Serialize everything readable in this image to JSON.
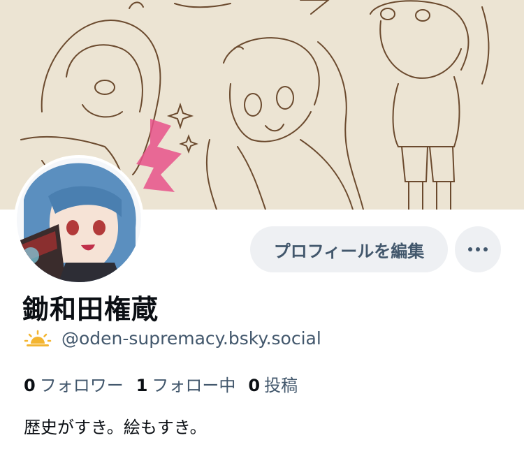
{
  "profile": {
    "display_name": "鋤和田権蔵",
    "handle": "@oden-supremacy.bsky.social",
    "handle_icon": "sunrise-icon",
    "bio": "歴史がすき。絵もすき。"
  },
  "actions": {
    "edit_label": "プロフィールを編集",
    "more_icon": "ellipsis-icon"
  },
  "stats": {
    "followers_count": "0",
    "followers_label": "フォロワー",
    "following_count": "1",
    "following_label": "フォロー中",
    "posts_count": "0",
    "posts_label": "投稿"
  },
  "colors": {
    "accent_text": "#42576c",
    "button_bg": "#eef0f3",
    "banner_bg": "#ece4d3",
    "sketch_line": "#6b4a2e",
    "banner_highlight": "#e8528a"
  }
}
